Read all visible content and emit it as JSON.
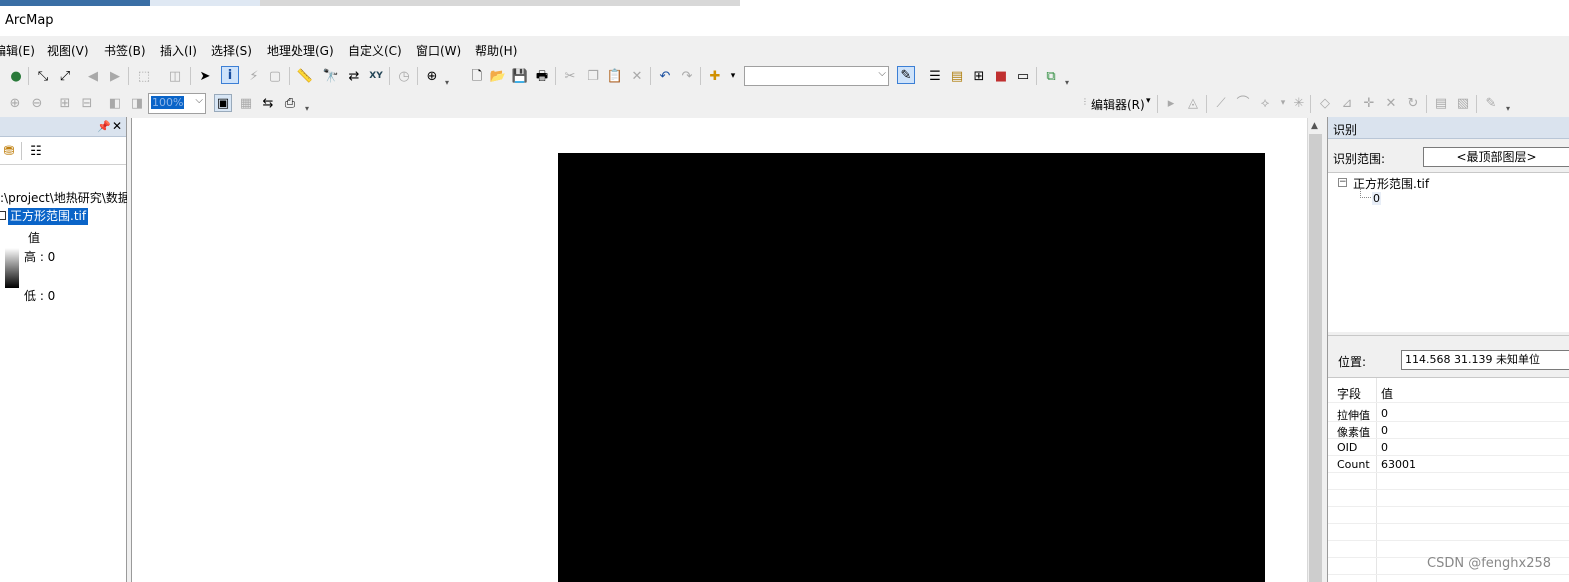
{
  "window": {
    "title": "ArcMap"
  },
  "menu": [
    "编辑(E)",
    "视图(V)",
    "书签(B)",
    "插入(I)",
    "选择(S)",
    "地理处理(G)",
    "自定义(C)",
    "窗口(W)",
    "帮助(H)"
  ],
  "toolbar": {
    "scale_value": "",
    "zoom_value": "100%",
    "editor_label": "编辑器(R)"
  },
  "toc": {
    "path": ":\\project\\地热研究\\数据",
    "layer_name": "正方形范围.tif",
    "legend_title": "值",
    "legend_high": "高 : 0",
    "legend_low": "低 : 0"
  },
  "identify": {
    "title": "识别",
    "scope_label": "识别范围:",
    "scope_value": "<最顶部图层>",
    "tree_layer": "正方形范围.tif",
    "tree_child": "0",
    "location_label": "位置:",
    "location_value": "114.568  31.139 未知单位",
    "field_header": "字段",
    "value_header": "值",
    "rows": [
      {
        "field": "拉伸值",
        "value": "0"
      },
      {
        "field": "像素值",
        "value": "0"
      },
      {
        "field": "OID",
        "value": "0"
      },
      {
        "field": "Count",
        "value": "63001"
      }
    ]
  },
  "watermark": "CSDN @fenghx258",
  "colors": {
    "selection": "#0a64c8",
    "panel_header": "#dae3ee",
    "raster": "#000000"
  }
}
